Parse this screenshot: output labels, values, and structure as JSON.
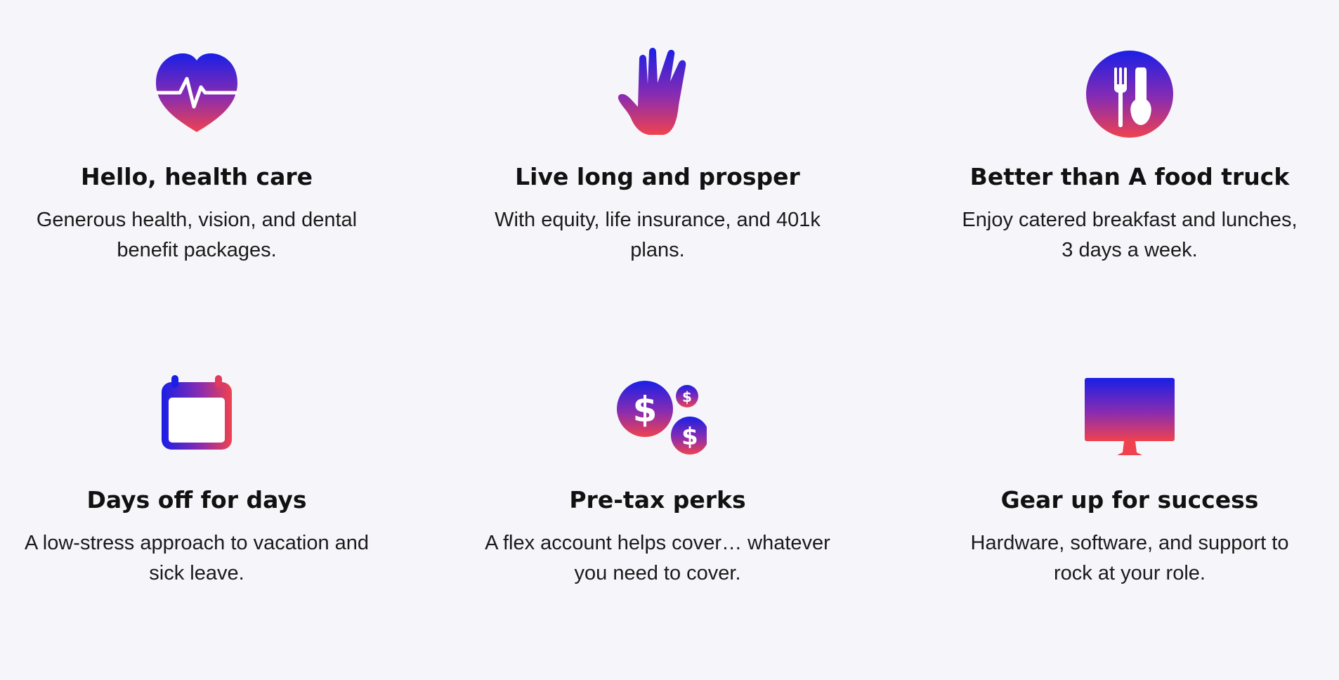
{
  "colors": {
    "background": "#f6f5fa",
    "gradient_top": "#1a1fe6",
    "gradient_bottom": "#f0424e",
    "heading": "#111111",
    "body_text": "#1a1a1a"
  },
  "perks": [
    {
      "icon": "heart-pulse-icon",
      "title": "Hello, health care",
      "description": "Generous health, vision, and dental benefit packages."
    },
    {
      "icon": "vulcan-salute-hand-icon",
      "title": "Live long and prosper",
      "description": "With equity, life insurance, and 401k plans."
    },
    {
      "icon": "fork-spoon-icon",
      "title": "Better than A food truck",
      "description": "Enjoy catered breakfast and lunches, 3 days a week."
    },
    {
      "icon": "calendar-icon",
      "title": "Days off for days",
      "description": "A low-stress approach to vacation and sick leave."
    },
    {
      "icon": "dollar-coins-icon",
      "title": "Pre-tax perks",
      "description": "A flex account helps cover… whatever you need to cover."
    },
    {
      "icon": "monitor-icon",
      "title": "Gear up for success",
      "description": "Hardware, software, and support to rock at your role."
    }
  ]
}
